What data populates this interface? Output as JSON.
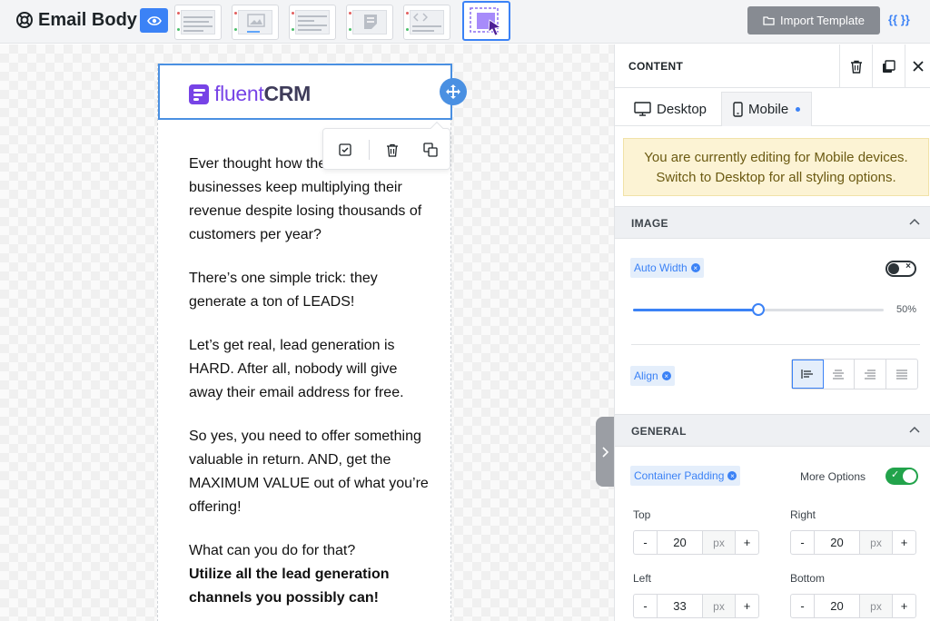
{
  "header": {
    "title": "Email Body",
    "import_label": "Import Template",
    "braces_label": "{{ }}"
  },
  "email": {
    "brand_light": "fluent",
    "brand_bold": "CRM",
    "paragraphs": [
      "Ever thought how the million businesses keep multiplying their revenue despite losing thousands of customers per year?",
      "There’s one simple trick: they generate a ton of LEADS!",
      "Let’s get real, lead generation is HARD. After all, nobody will give away their email address for free.",
      "So yes, you need to offer something valuable in return. AND, get the MAXIMUM VALUE out of what you’re offering!"
    ],
    "last_para_plain": "What can you do for that?",
    "last_para_bold": "Utilize all the lead generation channels you possibly can!"
  },
  "panel": {
    "title": "CONTENT",
    "tabs": {
      "desktop": "Desktop",
      "mobile": "Mobile"
    },
    "notice": "You are currently editing for Mobile devices. Switch to Desktop for all styling options.",
    "image_section": "IMAGE",
    "auto_width_label": "Auto Width",
    "auto_width_on": false,
    "width_value": "50%",
    "width_fraction": 0.5,
    "align_label": "Align",
    "align_selected": "left",
    "general_section": "GENERAL",
    "container_padding_label": "Container Padding",
    "more_options_label": "More Options",
    "more_options_on": true,
    "padding": {
      "top_label": "Top",
      "top_value": "20",
      "right_label": "Right",
      "right_value": "20",
      "left_label": "Left",
      "left_value": "33",
      "bottom_label": "Bottom",
      "bottom_value": "20",
      "unit": "px",
      "minus": "-",
      "plus": "+"
    }
  },
  "colors": {
    "accent": "#3b82f6",
    "brand": "#7743e6",
    "toggle_on": "#22a34b",
    "notice_bg": "#fcf3d4"
  }
}
